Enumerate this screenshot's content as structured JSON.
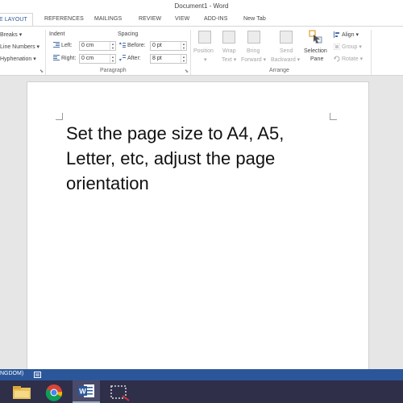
{
  "window": {
    "title": "Document1 - Word"
  },
  "tabs": [
    {
      "label": "E LAYOUT",
      "active": true
    },
    {
      "label": "REFERENCES"
    },
    {
      "label": "MAILINGS"
    },
    {
      "label": "REVIEW"
    },
    {
      "label": "VIEW"
    },
    {
      "label": "ADD-INS"
    },
    {
      "label": "New Tab"
    }
  ],
  "ribbon": {
    "page_setup_items": {
      "breaks": "Breaks",
      "line_numbers": "Line Numbers",
      "hyphenation": "Hyphenation"
    },
    "paragraph": {
      "indent_label": "Indent",
      "spacing_label": "Spacing",
      "left_label": "Left:",
      "left_value": "0 cm",
      "right_label": "Right:",
      "right_value": "0 cm",
      "before_label": "Before:",
      "before_value": "0 pt",
      "after_label": "After:",
      "after_value": "8 pt",
      "group_label": "Paragraph"
    },
    "arrange": {
      "position": "Position",
      "wrap_text_1": "Wrap",
      "wrap_text_2": "Text",
      "bring_forward_1": "Bring",
      "bring_forward_2": "Forward",
      "send_backward_1": "Send",
      "send_backward_2": "Backward",
      "selection_pane_1": "Selection",
      "selection_pane_2": "Pane",
      "align": "Align",
      "group": "Group",
      "rotate": "Rotate",
      "group_label": "Arrange"
    }
  },
  "document": {
    "text": "Set the page size to A4, A5, Letter, etc, adjust the page orientation"
  },
  "statusbar": {
    "language": "NGDOM)"
  },
  "taskbar": {
    "icons": [
      "file-explorer-icon",
      "chrome-icon",
      "word-icon",
      "snipping-tool-icon"
    ]
  },
  "colors": {
    "word_blue": "#2b579a",
    "taskbar": "#2f2f4a"
  }
}
